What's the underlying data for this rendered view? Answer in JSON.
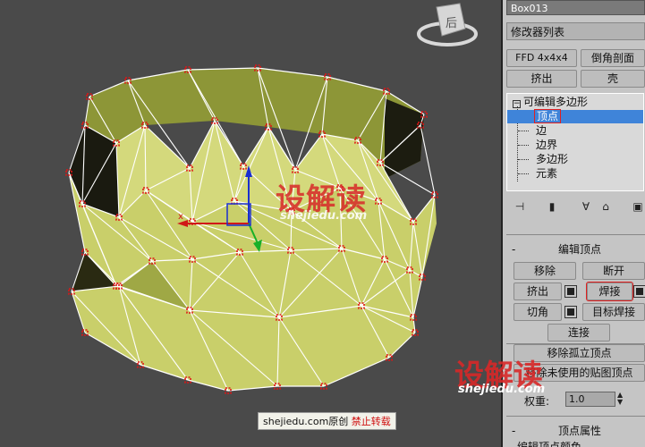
{
  "panel": {
    "object_name": "Box013",
    "modifier_list": "修改器列表",
    "buttons": {
      "ffd": "FFD 4x4x4",
      "bevel_profile": "倒角剖面",
      "extrude_top": "挤出",
      "shell": "壳"
    },
    "stack": {
      "root": "可编辑多边形",
      "items": [
        "顶点",
        "边",
        "边界",
        "多边形",
        "元素"
      ]
    },
    "edit_vertices": {
      "title": "编辑顶点",
      "remove": "移除",
      "break": "断开",
      "extrude": "挤出",
      "weld": "焊接",
      "chamfer": "切角",
      "target_weld": "目标焊接",
      "connect": "连接",
      "remove_isolated": "移除孤立顶点",
      "remove_unused_map": "移除未使用的贴图顶点",
      "weight_label": "权重:",
      "weight_value": "1.0"
    },
    "vertex_props": {
      "title": "顶点属性",
      "sub": "编辑顶点颜色"
    }
  },
  "viewport": {
    "viewcube_label": "后",
    "axis_x": "x"
  },
  "watermark": {
    "main": "设解读",
    "sub": "shejiedu.com"
  },
  "credit": {
    "site": "shejiedu.com原创",
    "notice": "禁止转载"
  },
  "colors": {
    "mesh_fill": "#c9cf6a",
    "mesh_dark": "#8d9637",
    "wire": "#ffffff",
    "vertex": "#e01515",
    "selection": "#3f84d9"
  }
}
